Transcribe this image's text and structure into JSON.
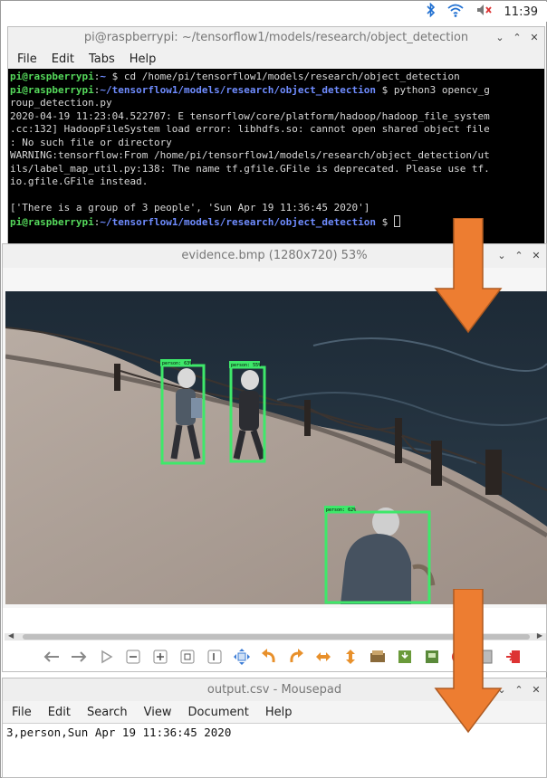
{
  "panel": {
    "clock": "11:39",
    "icons": [
      "bluetooth-icon",
      "wifi-icon",
      "volume-muted-icon"
    ]
  },
  "terminal": {
    "title": "pi@raspberrypi: ~/tensorflow1/models/research/object_detection",
    "menu": [
      "File",
      "Edit",
      "Tabs",
      "Help"
    ],
    "lines": {
      "l1_user": "pi@raspberrypi",
      "l1_sep": ":",
      "l1_path": "~",
      "l1_cmd": " $ cd /home/pi/tensorflow1/models/research/object_detection",
      "l2_user": "pi@raspberrypi",
      "l2_sep": ":",
      "l2_path": "~/tensorflow1/models/research/object_detection",
      "l2_cmd": " $ python3 opencv_g",
      "l3": "roup_detection.py",
      "l4": "2020-04-19 11:23:04.522707: E tensorflow/core/platform/hadoop/hadoop_file_system",
      "l5": ".cc:132] HadoopFileSystem load error: libhdfs.so: cannot open shared object file",
      "l6": ": No such file or directory",
      "l7": "WARNING:tensorflow:From /home/pi/tensorflow1/models/research/object_detection/ut",
      "l8": "ils/label_map_util.py:138: The name tf.gfile.GFile is deprecated. Please use tf.",
      "l9": "io.gfile.GFile instead.",
      "l10": "",
      "l11": "['There is a group of 3 people', 'Sun Apr 19 11:36:45 2020']",
      "l12_user": "pi@raspberrypi",
      "l12_sep": ":",
      "l12_path": "~/tensorflow1/models/research/object_detection",
      "l12_cmd": " $ "
    }
  },
  "viewer": {
    "title": "evidence.bmp (1280x720) 53%",
    "detections": [
      {
        "label": "person: 63%"
      },
      {
        "label": "person: 55%"
      },
      {
        "label": "person: 62%"
      }
    ],
    "toolbar_icons": [
      "back-icon",
      "forward-icon",
      "play-icon",
      "zoom-out-icon",
      "zoom-in-icon",
      "zoom-fit-icon",
      "zoom-original-icon",
      "fullscreen-icon",
      "rotate-left-icon",
      "rotate-right-icon",
      "flip-horizontal-icon",
      "flip-vertical-icon",
      "open-file-icon",
      "save-icon",
      "save-as-icon",
      "delete-icon",
      "preferences-icon",
      "exit-icon"
    ]
  },
  "mousepad": {
    "title": "output.csv - Mousepad",
    "menu": [
      "File",
      "Edit",
      "Search",
      "View",
      "Document",
      "Help"
    ],
    "content": "3,person,Sun Apr 19 11:36:45 2020"
  },
  "colors": {
    "arrow": "#ed7d31",
    "terminal_user": "#55d85b",
    "terminal_path": "#6f8cff",
    "bbox": "#3ee86a"
  }
}
